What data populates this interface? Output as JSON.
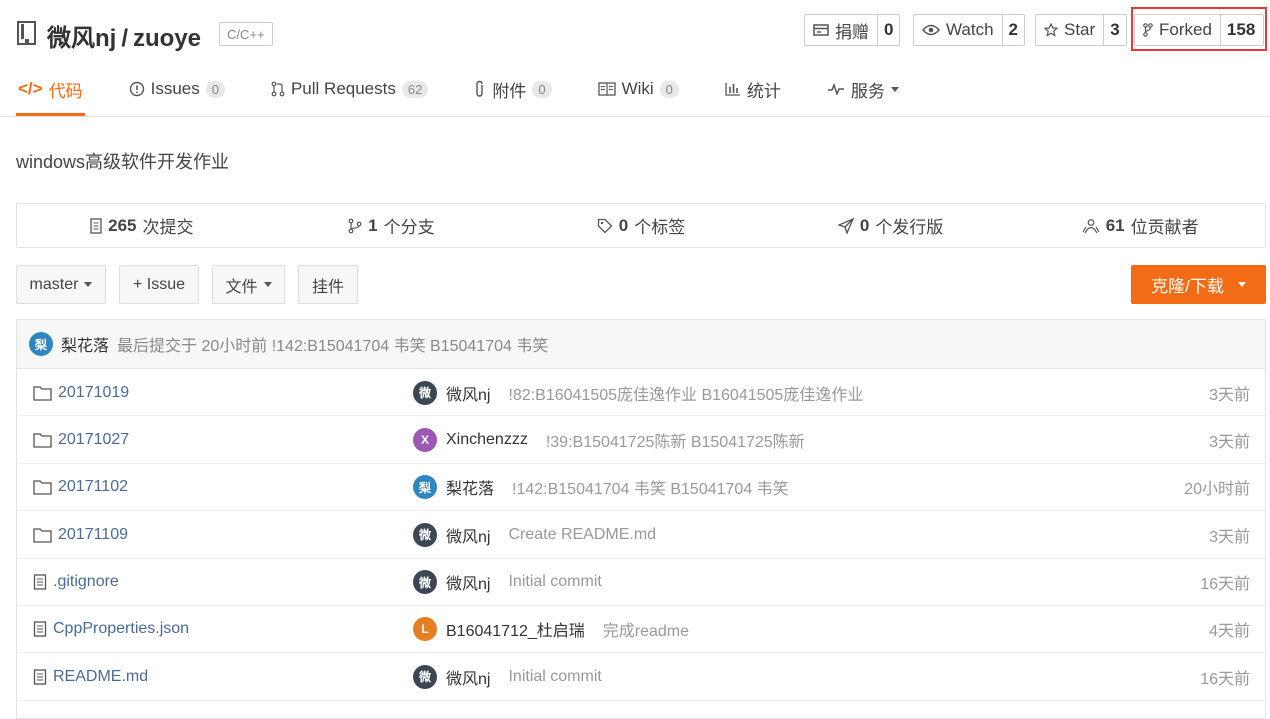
{
  "header": {
    "owner": "微风nj",
    "separator": "/",
    "repo": "zuoye",
    "language": "C/C++",
    "buttons": [
      {
        "label": "捐赠",
        "count": "0",
        "icon": "donate-icon"
      },
      {
        "label": "Watch",
        "count": "2",
        "icon": "eye-icon"
      },
      {
        "label": "Star",
        "count": "3",
        "icon": "star-icon"
      },
      {
        "label": "Forked",
        "count": "158",
        "icon": "fork-icon"
      }
    ]
  },
  "tabs": [
    {
      "label": "代码",
      "icon": "code-icon",
      "active": true
    },
    {
      "label": "Issues",
      "badge": "0",
      "icon": "issue-icon"
    },
    {
      "label": "Pull Requests",
      "badge": "62",
      "icon": "pull-request-icon"
    },
    {
      "label": "附件",
      "badge": "0",
      "icon": "attachment-icon"
    },
    {
      "label": "Wiki",
      "badge": "0",
      "icon": "wiki-icon"
    },
    {
      "label": "统计",
      "icon": "stats-icon"
    },
    {
      "label": "服务",
      "icon": "service-icon",
      "dropdown": true
    }
  ],
  "description": "windows高级软件开发作业",
  "stats": [
    {
      "num": "265",
      "label": "次提交"
    },
    {
      "num": "1",
      "label": "个分支"
    },
    {
      "num": "0",
      "label": "个标签"
    },
    {
      "num": "0",
      "label": "个发行版"
    },
    {
      "num": "61",
      "label": "位贡献者"
    }
  ],
  "toolbar": {
    "branch": "master",
    "issue": "+ Issue",
    "files": "文件",
    "widget": "挂件",
    "clone": "克隆/下载"
  },
  "last_commit": {
    "avatar": "梨",
    "author": "梨花落",
    "message": "最后提交于 20小时前 !142:B15041704 韦笑 B15041704 韦笑"
  },
  "files": [
    {
      "type": "folder",
      "name": "20171019",
      "avatar": "微",
      "color": "#3c4753",
      "user": "微风nj",
      "msg": "!82:B16041505庞佳逸作业 B16041505庞佳逸作业",
      "time": "3天前"
    },
    {
      "type": "folder",
      "name": "20171027",
      "avatar": "X",
      "color": "#9a59b5",
      "user": "Xinchenzzz",
      "msg": "!39:B15041725陈新 B15041725陈新",
      "time": "3天前"
    },
    {
      "type": "folder",
      "name": "20171102",
      "avatar": "梨",
      "color": "#2f86c1",
      "user": "梨花落",
      "msg": "!142:B15041704 韦笑 B15041704 韦笑",
      "time": "20小时前"
    },
    {
      "type": "folder",
      "name": "20171109",
      "avatar": "微",
      "color": "#3c4753",
      "user": "微风nj",
      "msg": "Create README.md",
      "time": "3天前"
    },
    {
      "type": "file",
      "name": ".gitignore",
      "avatar": "微",
      "color": "#3c4753",
      "user": "微风nj",
      "msg": "Initial commit",
      "time": "16天前"
    },
    {
      "type": "file",
      "name": "CppProperties.json",
      "avatar": "L",
      "color": "#e67e22",
      "user": "B16041712_杜启瑞",
      "msg": "完成readme",
      "time": "4天前"
    },
    {
      "type": "file",
      "name": "README.md",
      "avatar": "微",
      "color": "#3c4753",
      "user": "微风nj",
      "msg": "Initial commit",
      "time": "16天前"
    }
  ]
}
